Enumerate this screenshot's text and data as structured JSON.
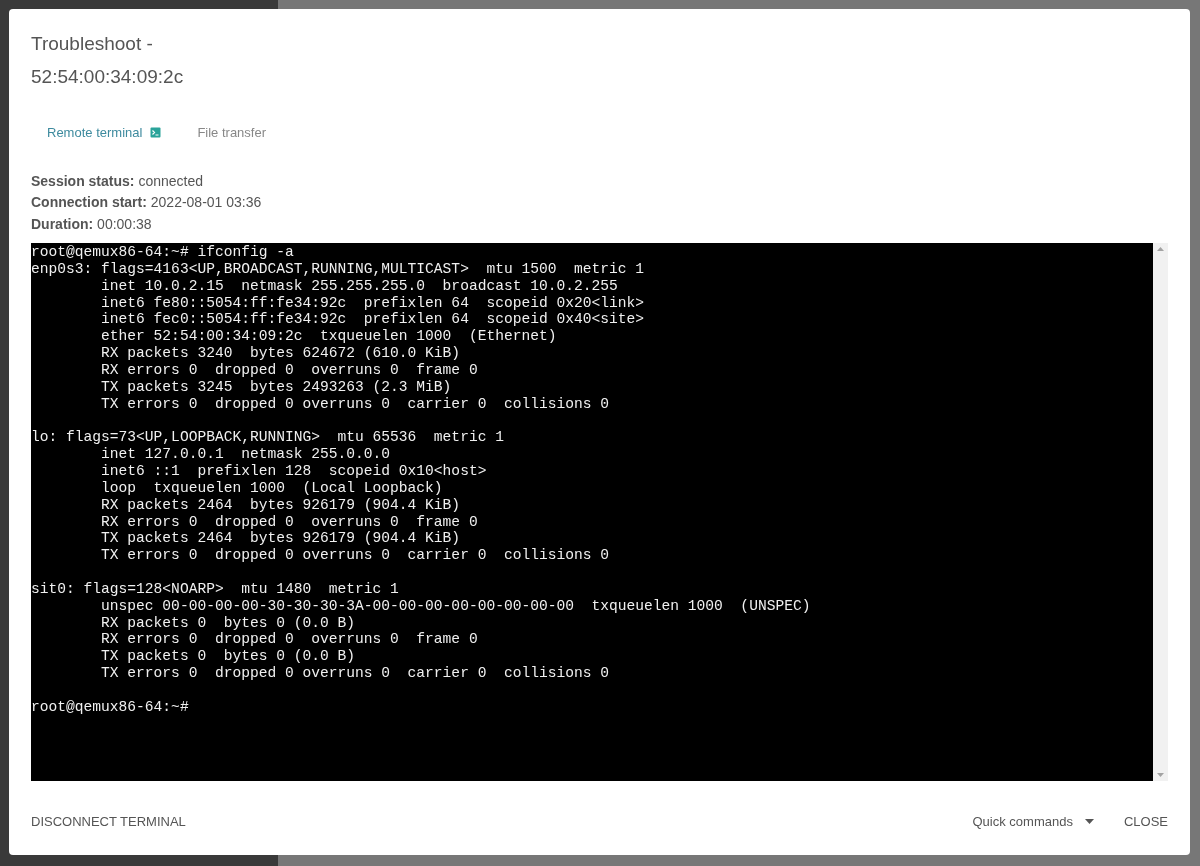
{
  "dialog": {
    "title_lines": [
      "Troubleshoot -",
      "52:54:00:34:09:2c"
    ]
  },
  "tabs": [
    {
      "label": "Remote terminal",
      "selected": true
    },
    {
      "label": "File transfer",
      "selected": false
    }
  ],
  "session": [
    {
      "label": "Session status:",
      "value": "connected"
    },
    {
      "label": "Connection start:",
      "value": "2022-08-01 03:36"
    },
    {
      "label": "Duration:",
      "value": "00:00:38"
    }
  ],
  "terminal": {
    "blocks": [
      [
        "root@qemux86-64:~# ifconfig -a",
        "enp0s3: flags=4163<UP,BROADCAST,RUNNING,MULTICAST>  mtu 1500  metric 1",
        "        inet 10.0.2.15  netmask 255.255.255.0  broadcast 10.0.2.255",
        "        inet6 fe80::5054:ff:fe34:92c  prefixlen 64  scopeid 0x20<link>",
        "        inet6 fec0::5054:ff:fe34:92c  prefixlen 64  scopeid 0x40<site>",
        "        ether 52:54:00:34:09:2c  txqueuelen 1000  (Ethernet)",
        "        RX packets 3240  bytes 624672 (610.0 KiB)",
        "        RX errors 0  dropped 0  overruns 0  frame 0",
        "        TX packets 3245  bytes 2493263 (2.3 MiB)",
        "        TX errors 0  dropped 0 overruns 0  carrier 0  collisions 0"
      ],
      [
        "lo: flags=73<UP,LOOPBACK,RUNNING>  mtu 65536  metric 1",
        "        inet 127.0.0.1  netmask 255.0.0.0",
        "        inet6 ::1  prefixlen 128  scopeid 0x10<host>",
        "        loop  txqueuelen 1000  (Local Loopback)",
        "        RX packets 2464  bytes 926179 (904.4 KiB)",
        "        RX errors 0  dropped 0  overruns 0  frame 0",
        "        TX packets 2464  bytes 926179 (904.4 KiB)",
        "        TX errors 0  dropped 0 overruns 0  carrier 0  collisions 0"
      ],
      [
        "sit0: flags=128<NOARP>  mtu 1480  metric 1",
        "        unspec 00-00-00-00-30-30-30-3A-00-00-00-00-00-00-00-00  txqueuelen 1000  (UNSPEC)",
        "        RX packets 0  bytes 0 (0.0 B)",
        "        RX errors 0  dropped 0  overruns 0  frame 0",
        "        TX packets 0  bytes 0 (0.0 B)",
        "        TX errors 0  dropped 0 overruns 0  carrier 0  collisions 0"
      ],
      [
        "root@qemux86-64:~#"
      ]
    ]
  },
  "footer": {
    "disconnect": "DISCONNECT TERMINAL",
    "quick_commands": "Quick commands",
    "close": "CLOSE"
  }
}
